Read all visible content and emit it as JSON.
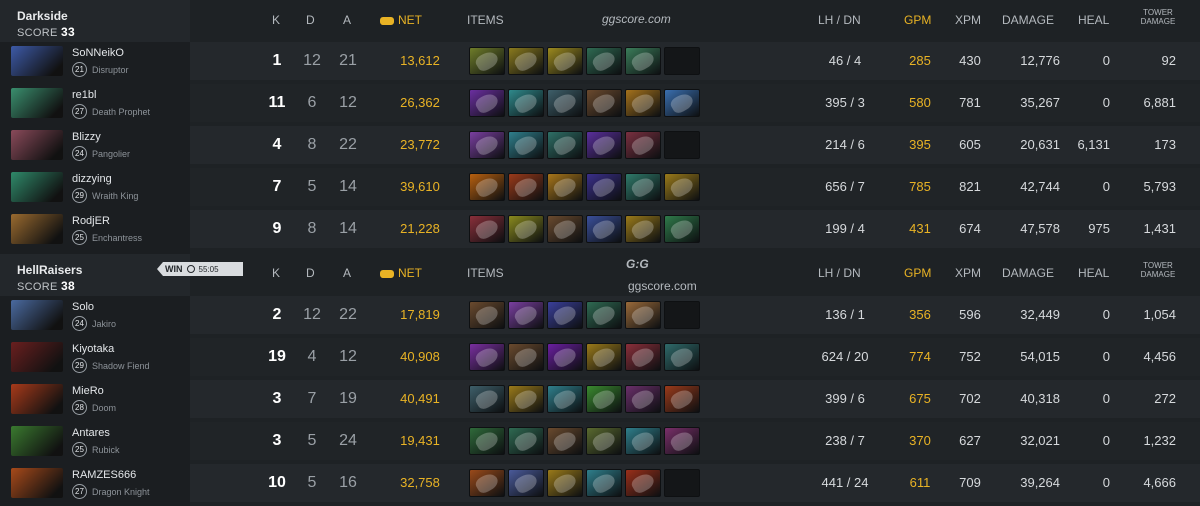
{
  "columns": {
    "k": "K",
    "d": "D",
    "a": "A",
    "net": "NET",
    "items": "ITEMS",
    "lhdn": "LH / DN",
    "gpm": "GPM",
    "xpm": "XPM",
    "damage": "DAMAGE",
    "heal": "HEAL",
    "tower_line1": "TOWER",
    "tower_line2": "DAMAGE"
  },
  "watermark": {
    "top": "ggscore.com",
    "logo": "G:G",
    "logo_sub": "ggscore.com"
  },
  "colors": {
    "gold": "#e9b325",
    "background": "#1e2225",
    "row": "#24282c"
  },
  "teams": [
    {
      "name": "Darkside",
      "score_label": "SCORE",
      "score": "33",
      "players": [
        {
          "name": "SoNNeikO",
          "level": "21",
          "hero": "Disruptor",
          "portrait_color": "#3d5aa8",
          "k": "1",
          "d": "12",
          "a": "21",
          "net": "13,612",
          "lhdn": "46  /  4",
          "gpm": "285",
          "xpm": "430",
          "damage": "12,776",
          "heal": "0",
          "tower": "92",
          "items": [
            "#6f7d2a",
            "#8a7a1e",
            "#9c8a1f",
            "#2f6a52",
            "#3b7d5a",
            "empty"
          ]
        },
        {
          "name": "re1bl",
          "level": "27",
          "hero": "Death Prophet",
          "portrait_color": "#3a8f6e",
          "k": "11",
          "d": "6",
          "a": "12",
          "net": "26,362",
          "lhdn": "395  /  3",
          "gpm": "580",
          "xpm": "781",
          "damage": "35,267",
          "heal": "0",
          "tower": "6,881",
          "items": [
            "#6b2fa0",
            "#2f8a8c",
            "#3e5f6a",
            "#6b4a2e",
            "#a5721c",
            "#3a6fb0"
          ]
        },
        {
          "name": "Blizzy",
          "level": "24",
          "hero": "Pangolier",
          "portrait_color": "#8a4a5a",
          "k": "4",
          "d": "8",
          "a": "22",
          "net": "23,772",
          "lhdn": "214  /  6",
          "gpm": "395",
          "xpm": "605",
          "damage": "20,631",
          "heal": "6,131",
          "tower": "173",
          "items": [
            "#7a3fa0",
            "#2f7f8c",
            "#2e6f66",
            "#5a2f9c",
            "#7a3040",
            "empty"
          ]
        },
        {
          "name": "dizzying",
          "level": "29",
          "hero": "Wraith King",
          "portrait_color": "#2f8a6a",
          "k": "7",
          "d": "5",
          "a": "14",
          "net": "39,610",
          "lhdn": "656  /  7",
          "gpm": "785",
          "xpm": "821",
          "damage": "42,744",
          "heal": "0",
          "tower": "5,793",
          "items": [
            "#b8600f",
            "#9a3a1a",
            "#a8761a",
            "#3a2f8a",
            "#2f7a6a",
            "#9a7a1a"
          ]
        },
        {
          "name": "RodjER",
          "level": "25",
          "hero": "Enchantress",
          "portrait_color": "#9a6a2f",
          "k": "9",
          "d": "8",
          "a": "14",
          "net": "21,228",
          "lhdn": "199  /  4",
          "gpm": "431",
          "xpm": "674",
          "damage": "47,578",
          "heal": "975",
          "tower": "1,431",
          "items": [
            "#8a2f3a",
            "#8a8a1e",
            "#6a4a2e",
            "#3a4f9a",
            "#9a7a1a",
            "#2f7a4a"
          ]
        }
      ]
    },
    {
      "name": "HellRaisers",
      "score_label": "SCORE",
      "score": "38",
      "win_label": "WIN",
      "win_time": "55:05",
      "players": [
        {
          "name": "Solo",
          "level": "24",
          "hero": "Jakiro",
          "portrait_color": "#4a6aa0",
          "k": "2",
          "d": "12",
          "a": "22",
          "net": "17,819",
          "lhdn": "136  /  1",
          "gpm": "356",
          "xpm": "596",
          "damage": "32,449",
          "heal": "0",
          "tower": "1,054",
          "items": [
            "#6a4a2e",
            "#7a3fa0",
            "#3a3f9a",
            "#2f6a52",
            "#9a6a3a",
            "empty"
          ]
        },
        {
          "name": "Kiyotaka",
          "level": "29",
          "hero": "Shadow Fiend",
          "portrait_color": "#6a1f1f",
          "k": "19",
          "d": "4",
          "a": "12",
          "net": "40,908",
          "lhdn": "624  /  20",
          "gpm": "774",
          "xpm": "752",
          "damage": "54,015",
          "heal": "0",
          "tower": "4,456",
          "items": [
            "#7a2fa0",
            "#6a4a2e",
            "#6a1fa0",
            "#9a7a1a",
            "#8a2f3a",
            "#2f6a6a"
          ]
        },
        {
          "name": "MieRo",
          "level": "28",
          "hero": "Doom",
          "portrait_color": "#a83a1a",
          "k": "3",
          "d": "7",
          "a": "19",
          "net": "40,491",
          "lhdn": "399  /  6",
          "gpm": "675",
          "xpm": "702",
          "damage": "40,318",
          "heal": "0",
          "tower": "272",
          "items": [
            "#3e5f6a",
            "#9a7a1a",
            "#2f7f8c",
            "#3a8a2f",
            "#6a2f6a",
            "#9a3a1a"
          ]
        },
        {
          "name": "Antares",
          "level": "25",
          "hero": "Rubick",
          "portrait_color": "#3a7a2f",
          "k": "3",
          "d": "5",
          "a": "24",
          "net": "19,431",
          "lhdn": "238  /  7",
          "gpm": "370",
          "xpm": "627",
          "damage": "32,021",
          "heal": "0",
          "tower": "1,232",
          "items": [
            "#2f6a3a",
            "#2f6a52",
            "#6a4a2e",
            "#5a6a2f",
            "#2f7f8c",
            "#7a2f6a"
          ]
        },
        {
          "name": "RAMZES666",
          "level": "27",
          "hero": "Dragon Knight",
          "portrait_color": "#a84a1a",
          "k": "10",
          "d": "5",
          "a": "16",
          "net": "32,758",
          "lhdn": "441  /  24",
          "gpm": "611",
          "xpm": "709",
          "damage": "39,264",
          "heal": "0",
          "tower": "4,666",
          "items": [
            "#9a4a1a",
            "#4a5a9a",
            "#9a7a1a",
            "#2f7f8c",
            "#9a2f1a",
            "empty"
          ]
        }
      ]
    }
  ]
}
